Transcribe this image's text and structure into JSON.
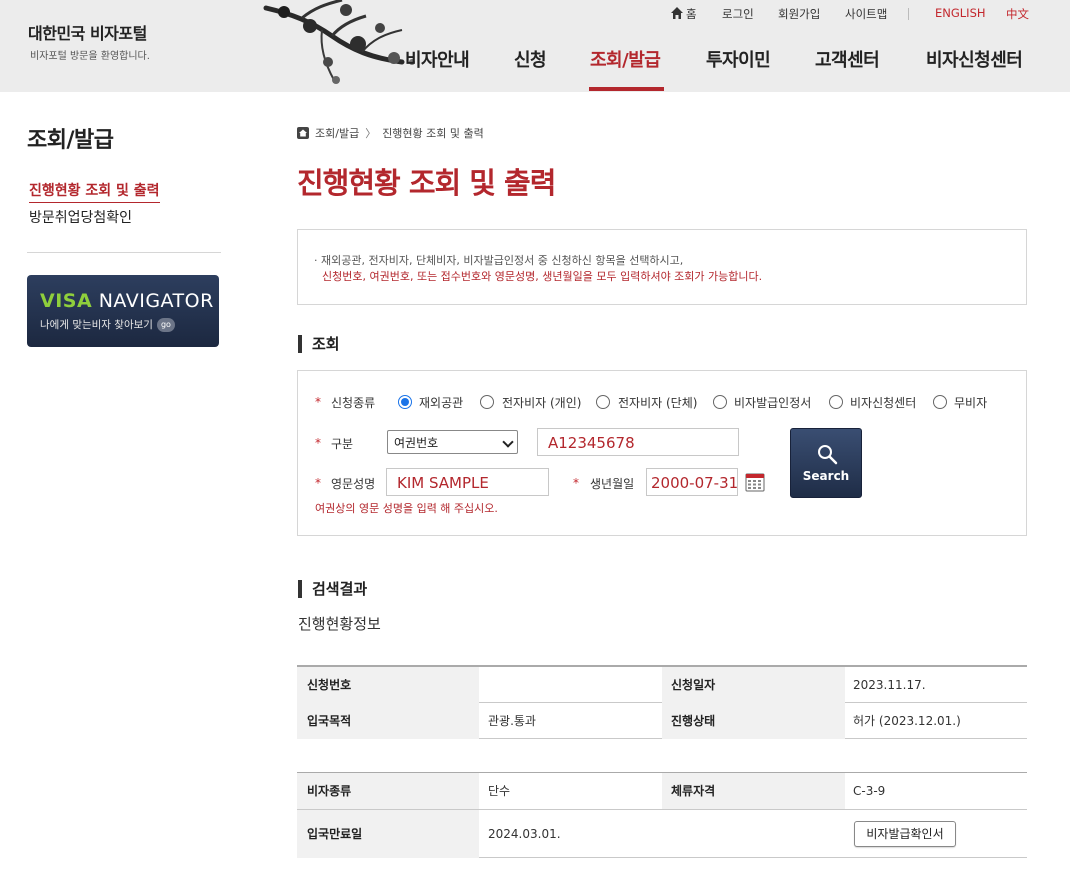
{
  "header": {
    "logo_title": "대한민국 비자포털",
    "logo_subtitle": "비자포털 방문을 환영합니다.",
    "util": {
      "home": "홈",
      "login": "로그인",
      "signup": "회원가입",
      "sitemap": "사이트맵",
      "english": "ENGLISH",
      "chinese": "中文"
    },
    "gnb": [
      {
        "label": "비자안내",
        "active": false
      },
      {
        "label": "신청",
        "active": false
      },
      {
        "label": "조회/발급",
        "active": true
      },
      {
        "label": "투자이민",
        "active": false
      },
      {
        "label": "고객센터",
        "active": false
      },
      {
        "label": "비자신청센터",
        "active": false
      }
    ],
    "accent_color": "#b3272d"
  },
  "sidebar": {
    "title": "조회/발급",
    "items": [
      {
        "label": "진행현황 조회 및 출력",
        "active": true
      },
      {
        "label": "방문취업당첨확인",
        "active": false
      }
    ],
    "banner": {
      "word1": "VISA",
      "word2": "NAVIGATOR",
      "subtitle": "나에게 맞는비자 찾아보기",
      "badge": "go"
    }
  },
  "main": {
    "breadcrumb": [
      "조회/발급",
      "진행현황 조회 및 출력"
    ],
    "title": "진행현황 조회 및 출력",
    "notice_line1": "· 재외공관, 전자비자, 단체비자, 비자발급인정서 중 신청하신 항목을 선택하시고,",
    "notice_line2": "신청번호, 여권번호, 또는 접수번호와 영문성명, 생년월일을 모두 입력하셔야 조회가 가능합니다.",
    "search_section_title": "조회",
    "form": {
      "type_label": "신청종류",
      "type_options": [
        {
          "label": "재외공관",
          "checked": true
        },
        {
          "label": "전자비자 (개인)",
          "checked": false
        },
        {
          "label": "전자비자 (단체)",
          "checked": false
        },
        {
          "label": "비자발급인정서",
          "checked": false
        },
        {
          "label": "비자신청센터",
          "checked": false
        },
        {
          "label": "무비자",
          "checked": false
        }
      ],
      "category_label": "구분",
      "category_selected": "여권번호",
      "number_value": "A12345678",
      "name_label": "영문성명",
      "name_value": "KIM SAMPLE",
      "dob_label": "생년월일",
      "dob_value": "2000-07-31",
      "search_button": "Search",
      "hint": "여권상의 영문 성명을 입력 해 주십시오."
    },
    "result_section_title": "검색결과",
    "result_subtitle": "진행현황정보",
    "table1": [
      {
        "h1": "신청번호",
        "v1": "",
        "h2": "신청일자",
        "v2": "2023.11.17."
      },
      {
        "h1": "입국목적",
        "v1": "관광.통과",
        "h2": "진행상태",
        "v2": "허가 (2023.12.01.)"
      }
    ],
    "table2": [
      {
        "h1": "비자종류",
        "v1": "단수",
        "h2": "체류자격",
        "v2": "C-3-9"
      },
      {
        "h1": "입국만료일",
        "v1": "2024.03.01.",
        "h2": "",
        "v2": ""
      }
    ],
    "issue_button": "비자발급확인서"
  }
}
